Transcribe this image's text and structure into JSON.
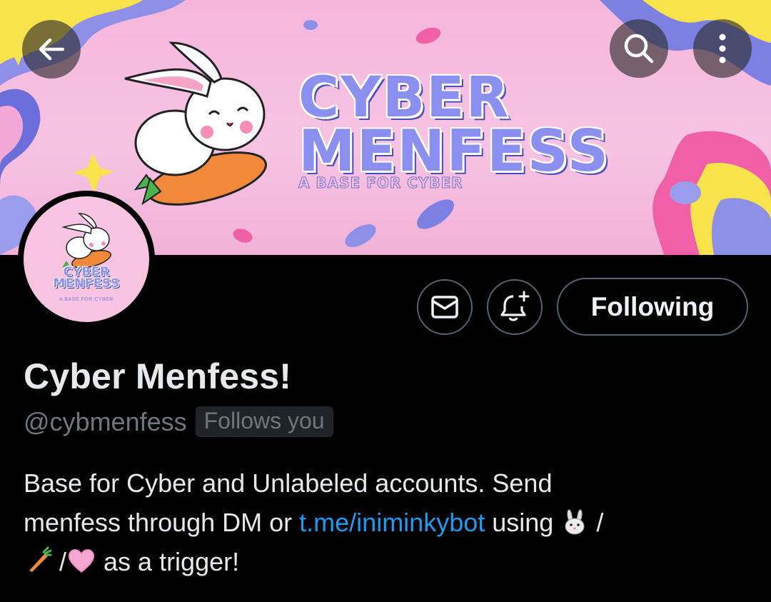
{
  "banner": {
    "title_line1": "CYBER",
    "title_line2": "MENFESS",
    "subtitle": "A BASE FOR CYBER"
  },
  "avatar": {
    "title_line1": "CYBER",
    "title_line2": "MENFESS",
    "subtitle": "A BASE FOR CYBER"
  },
  "nav": {
    "back_icon": "arrow-left-icon",
    "search_icon": "search-icon",
    "more_icon": "more-vertical-icon"
  },
  "actions": {
    "message_icon": "envelope-icon",
    "notify_icon": "bell-plus-icon",
    "following_label": "Following"
  },
  "profile": {
    "display_name": "Cyber Menfess!",
    "handle": "@cybmenfess",
    "follows_you": "Follows you",
    "bio": {
      "line1": "Base for Cyber and Unlabeled accounts. Send",
      "line2_start": "menfess through DM or ",
      "link": "t.me/iniminkybot",
      "line2_after_link": " using ",
      "slash1": " /",
      "slash2": " /",
      "line3_end": " as a trigger!"
    }
  },
  "colors": {
    "background": "#000000",
    "link": "#1d9bf0",
    "muted": "#71767b",
    "border": "#536471",
    "banner_pink": "#f7c3e3",
    "logo_blue": "#8b90f0"
  }
}
